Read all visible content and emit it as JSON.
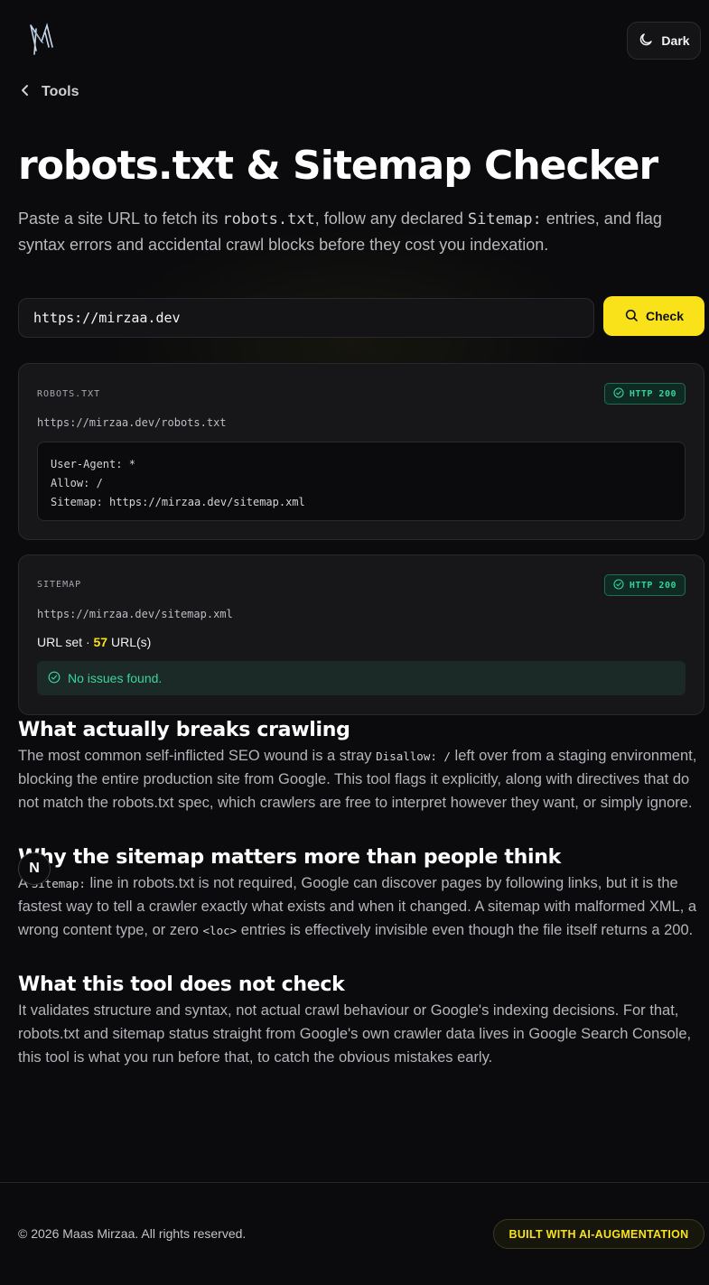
{
  "header": {
    "theme_label": "Dark",
    "back_label": "Tools"
  },
  "hero": {
    "title": "robots.txt & Sitemap Checker",
    "intro_1": "Paste a site URL to fetch its ",
    "intro_code_1": "robots.txt",
    "intro_2": ", follow any declared ",
    "intro_code_2": "Sitemap:",
    "intro_3": " entries, and flag syntax errors and accidental crawl blocks before they cost you indexation."
  },
  "search": {
    "value": "https://mirzaa.dev",
    "button_label": "Check"
  },
  "robots_card": {
    "label": "ROBOTS.TXT",
    "status": "HTTP 200",
    "url": "https://mirzaa.dev/robots.txt",
    "lines": [
      "User-Agent: *",
      "Allow: /",
      "Sitemap: https://mirzaa.dev/sitemap.xml"
    ]
  },
  "sitemap_card": {
    "label": "SITEMAP",
    "status": "HTTP 200",
    "url": "https://mirzaa.dev/sitemap.xml",
    "type_prefix": "URL set · ",
    "count": "57",
    "count_suffix": " URL(s)",
    "message": "No issues found."
  },
  "sections": [
    {
      "heading": "What actually breaks crawling",
      "p1": "The most common self-inflicted SEO wound is a stray ",
      "code": "Disallow: /",
      "p2": " left over from a staging environment, blocking the entire production site from Google. This tool flags it explicitly, along with directives that do not match the robots.txt spec, which crawlers are free to interpret however they want, or simply ignore."
    },
    {
      "heading": "Why the sitemap matters more than people think",
      "p1": "A ",
      "code": "Sitemap:",
      "p2": " line in robots.txt is not required, Google can discover pages by following links, but it is the fastest way to tell a crawler exactly what exists and when it changed. A sitemap with malformed XML, a wrong content type, or zero ",
      "code2": "<loc>",
      "p3": " entries is effectively invisible even though the file itself returns a 200."
    },
    {
      "heading": "What this tool does not check",
      "p1": "It validates structure and syntax, not actual crawl behaviour or Google's indexing decisions. For that, robots.txt and sitemap status straight from Google's own crawler data lives in Google Search Console, this tool is what you run before that, to catch the obvious mistakes early."
    }
  ],
  "floating_badge": "N",
  "footer": {
    "copyright": "© 2026 Maas Mirzaa. All rights reserved.",
    "badge": "BUILT WITH AI-AUGMENTATION"
  },
  "icons": {
    "logo": "logo-icon",
    "theme": "moon-icon",
    "back": "chevron-left-icon",
    "search": "search-icon",
    "status": "check-circle-icon"
  },
  "colors": {
    "accent": "#f9e21a",
    "success": "#35d29a",
    "background": "#0b0b0d"
  }
}
